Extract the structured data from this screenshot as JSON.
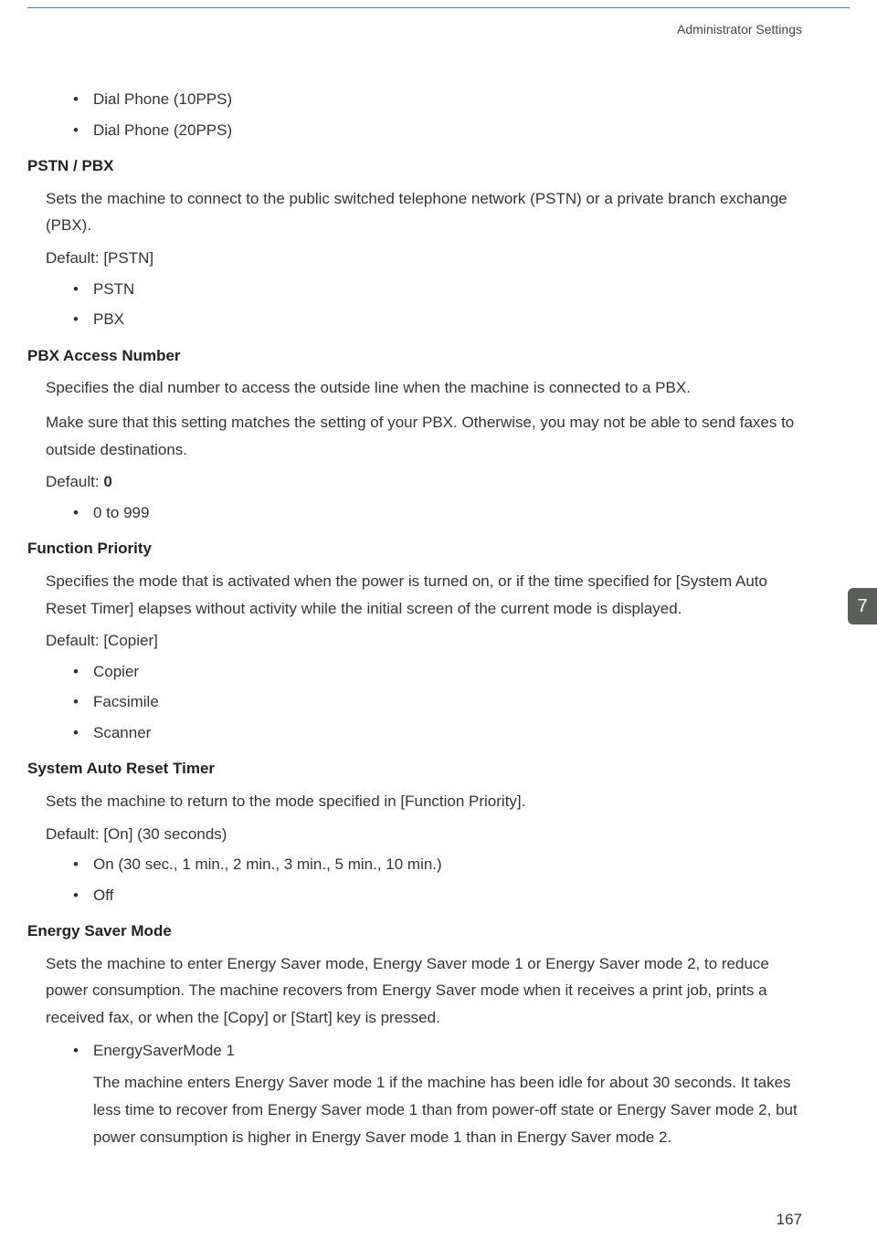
{
  "header": {
    "section_title": "Administrator Settings"
  },
  "side_tab": "7",
  "page_number": "167",
  "intro_bullets": [
    "Dial Phone (10PPS)",
    "Dial Phone (20PPS)"
  ],
  "sections": [
    {
      "title": "PSTN / PBX",
      "paragraphs": [
        "Sets the machine to connect to the public switched telephone network (PSTN) or a private branch exchange (PBX)."
      ],
      "default_prefix": "Default: ",
      "default_value": "[PSTN]",
      "bullets": [
        "PSTN",
        "PBX"
      ]
    },
    {
      "title": "PBX Access Number",
      "paragraphs": [
        "Specifies the dial number to access the outside line when the machine is connected to a PBX.",
        "Make sure that this setting matches the setting of your PBX. Otherwise, you may not be able to send faxes to outside destinations."
      ],
      "default_prefix": "Default: ",
      "default_value_bold": "0",
      "bullets": [
        "0 to 999"
      ]
    },
    {
      "title": "Function Priority",
      "paragraphs": [
        "Specifies the mode that is activated when the power is turned on, or if the time specified for [System Auto Reset Timer] elapses without activity while the initial screen of the current mode is displayed."
      ],
      "default_prefix": "Default: ",
      "default_value": "[Copier]",
      "bullets": [
        "Copier",
        "Facsimile",
        "Scanner"
      ]
    },
    {
      "title": "System Auto Reset Timer",
      "paragraphs": [
        "Sets the machine to return to the mode specified in [Function Priority]."
      ],
      "default_prefix": "Default: ",
      "default_value": "[On] (30 seconds)",
      "bullets": [
        "On (30 sec., 1 min., 2 min., 3 min., 5 min., 10 min.)",
        "Off"
      ]
    },
    {
      "title": "Energy Saver Mode",
      "paragraphs": [
        "Sets the machine to enter Energy Saver mode, Energy Saver mode 1 or Energy Saver mode 2, to reduce power consumption. The machine recovers from Energy Saver mode when it receives a print job, prints a received fax, or when the [Copy] or [Start] key is pressed."
      ],
      "complex_bullets": [
        {
          "label": "EnergySaverMode 1",
          "sub": "The machine enters Energy Saver mode 1 if the machine has been idle for about 30 seconds. It takes less time to recover from Energy Saver mode 1 than from power-off state or Energy Saver mode 2, but power consumption is higher in Energy Saver mode 1 than in Energy Saver mode 2."
        }
      ]
    }
  ]
}
